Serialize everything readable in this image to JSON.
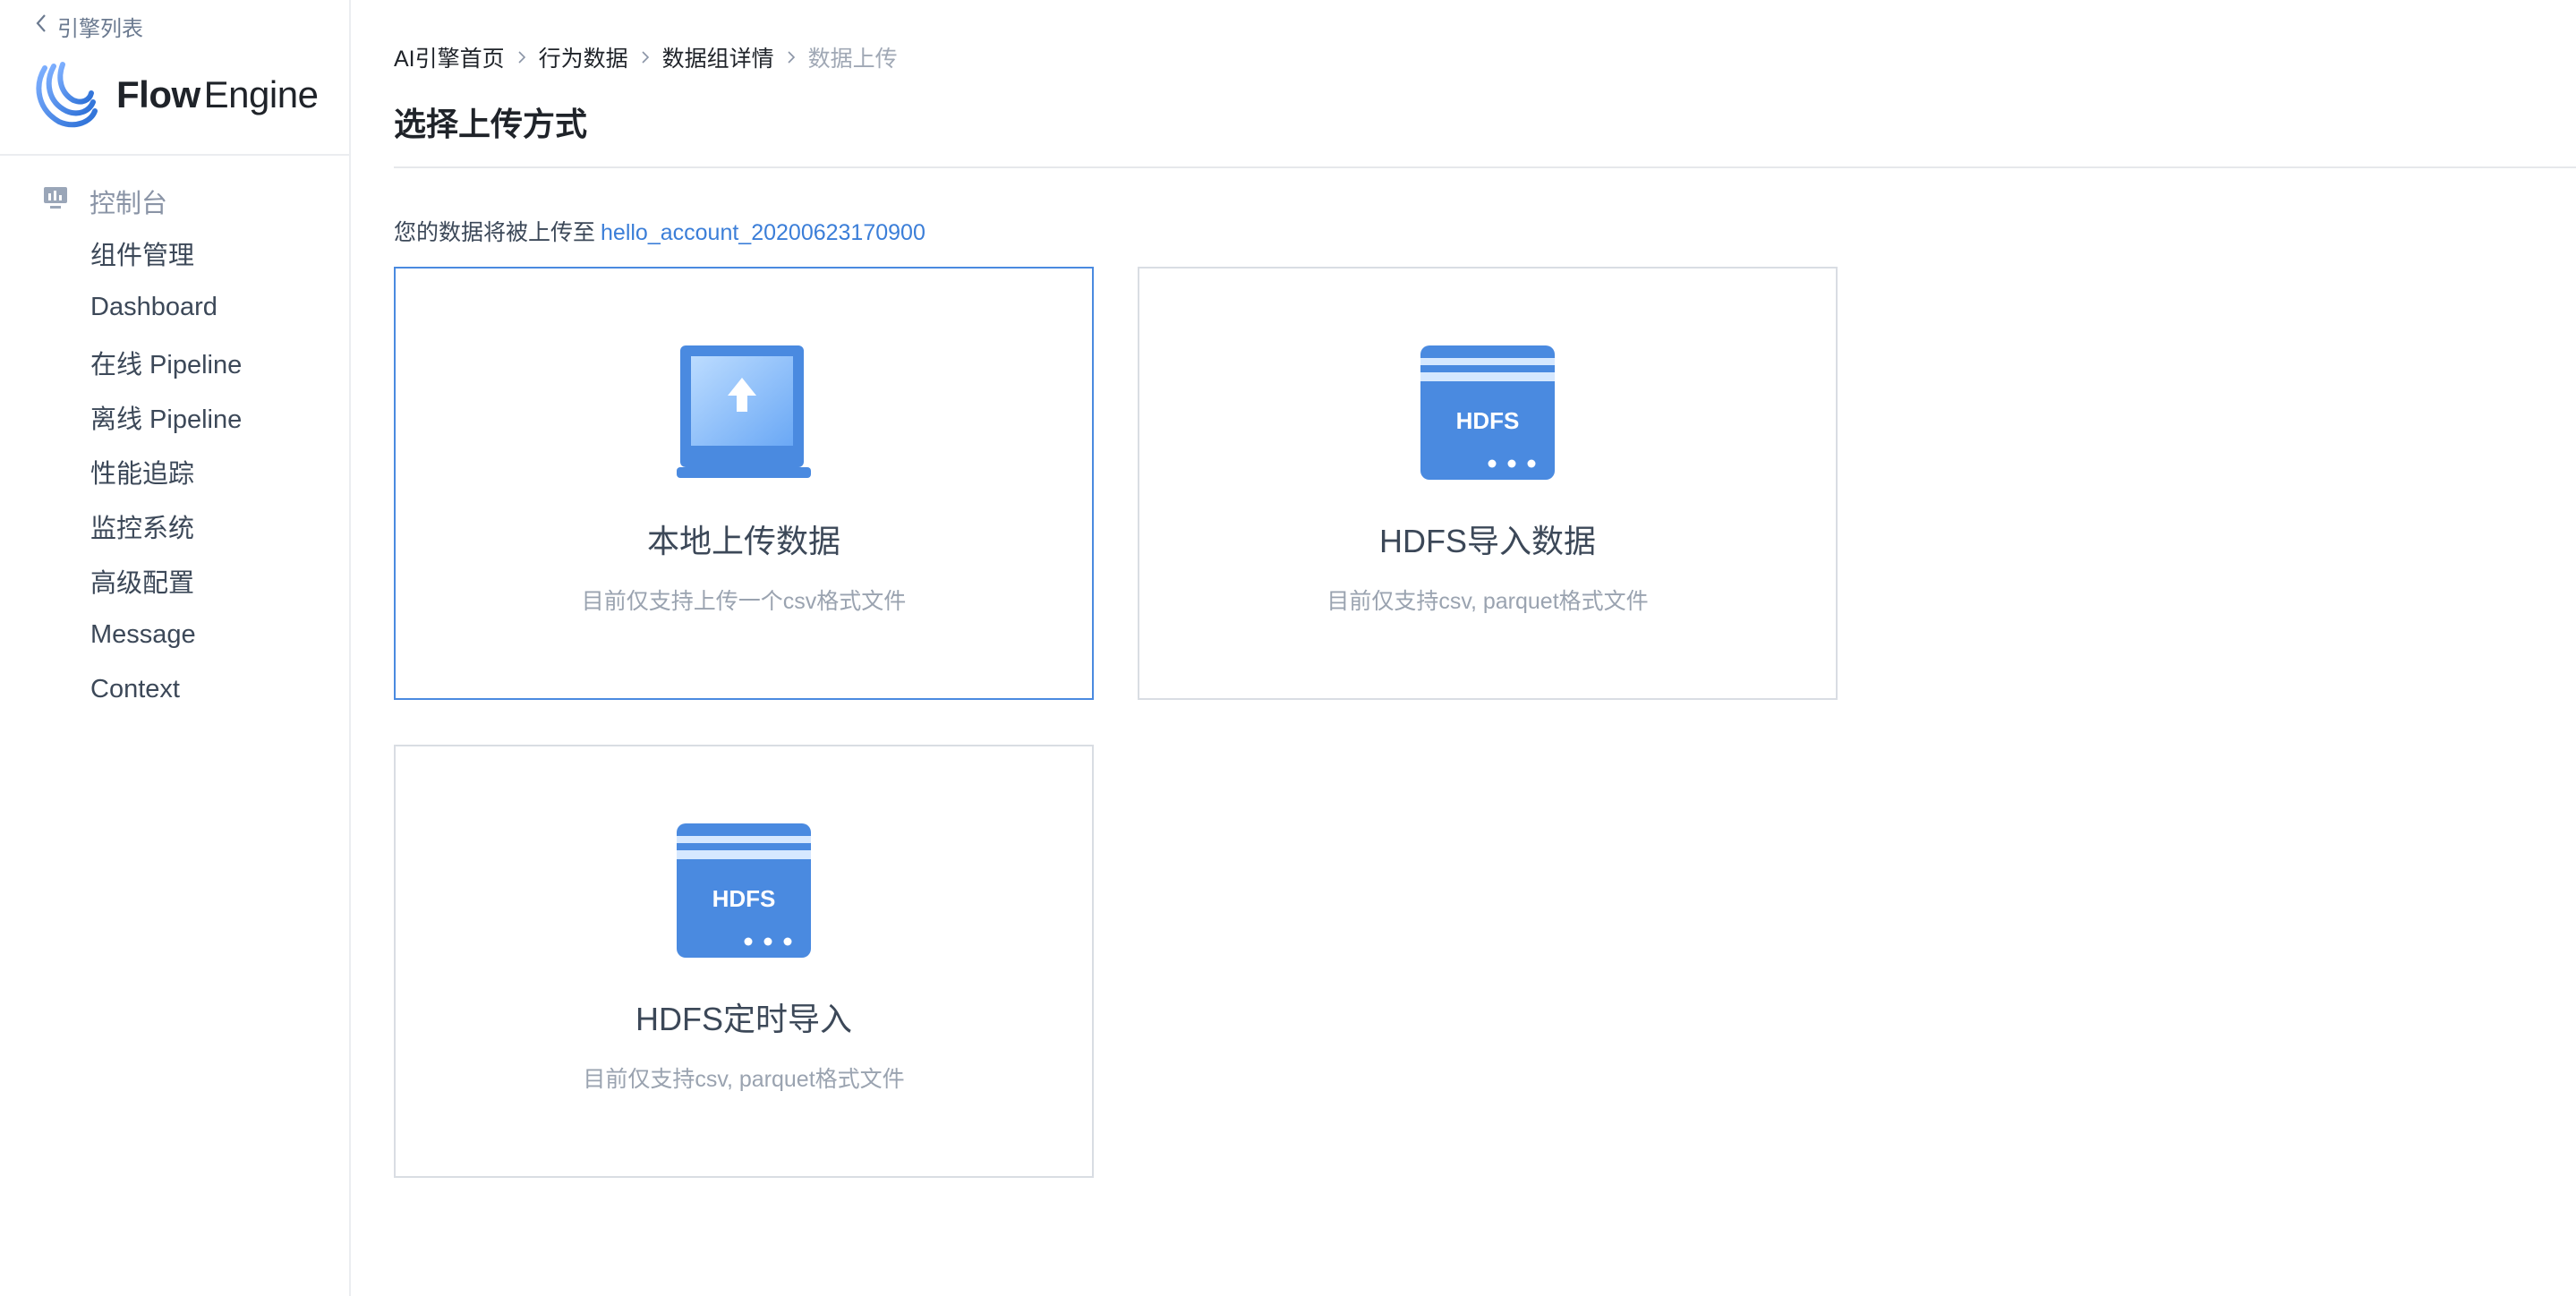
{
  "sidebar": {
    "back_label": "引擎列表",
    "logo": {
      "flow": "Flow",
      "engine": "Engine"
    },
    "group_title": "控制台",
    "items": [
      {
        "label": "组件管理"
      },
      {
        "label": "Dashboard"
      },
      {
        "label": "在线 Pipeline"
      },
      {
        "label": "离线 Pipeline"
      },
      {
        "label": "性能追踪"
      },
      {
        "label": "监控系统"
      },
      {
        "label": "高级配置"
      },
      {
        "label": "Message"
      },
      {
        "label": "Context"
      }
    ]
  },
  "breadcrumb": [
    {
      "label": "AI引擎首页"
    },
    {
      "label": "行为数据"
    },
    {
      "label": "数据组详情"
    },
    {
      "label": "数据上传"
    }
  ],
  "page_title": "选择上传方式",
  "target": {
    "prefix": "您的数据将被上传至",
    "account": "hello_account_20200623170900"
  },
  "cards": [
    {
      "title": "本地上传数据",
      "desc": "目前仅支持上传一个csv格式文件",
      "icon": "laptop-upload-icon",
      "selected": true
    },
    {
      "title": "HDFS导入数据",
      "desc": "目前仅支持csv, parquet格式文件",
      "icon": "hdfs-server-icon",
      "badge": "HDFS",
      "selected": false
    },
    {
      "title": "HDFS定时导入",
      "desc": "目前仅支持csv, parquet格式文件",
      "icon": "hdfs-server-icon",
      "badge": "HDFS",
      "selected": false
    }
  ],
  "colors": {
    "accent": "#3b7ed8",
    "icon_blue": "#4a8ae0",
    "border": "#d9dde3"
  }
}
